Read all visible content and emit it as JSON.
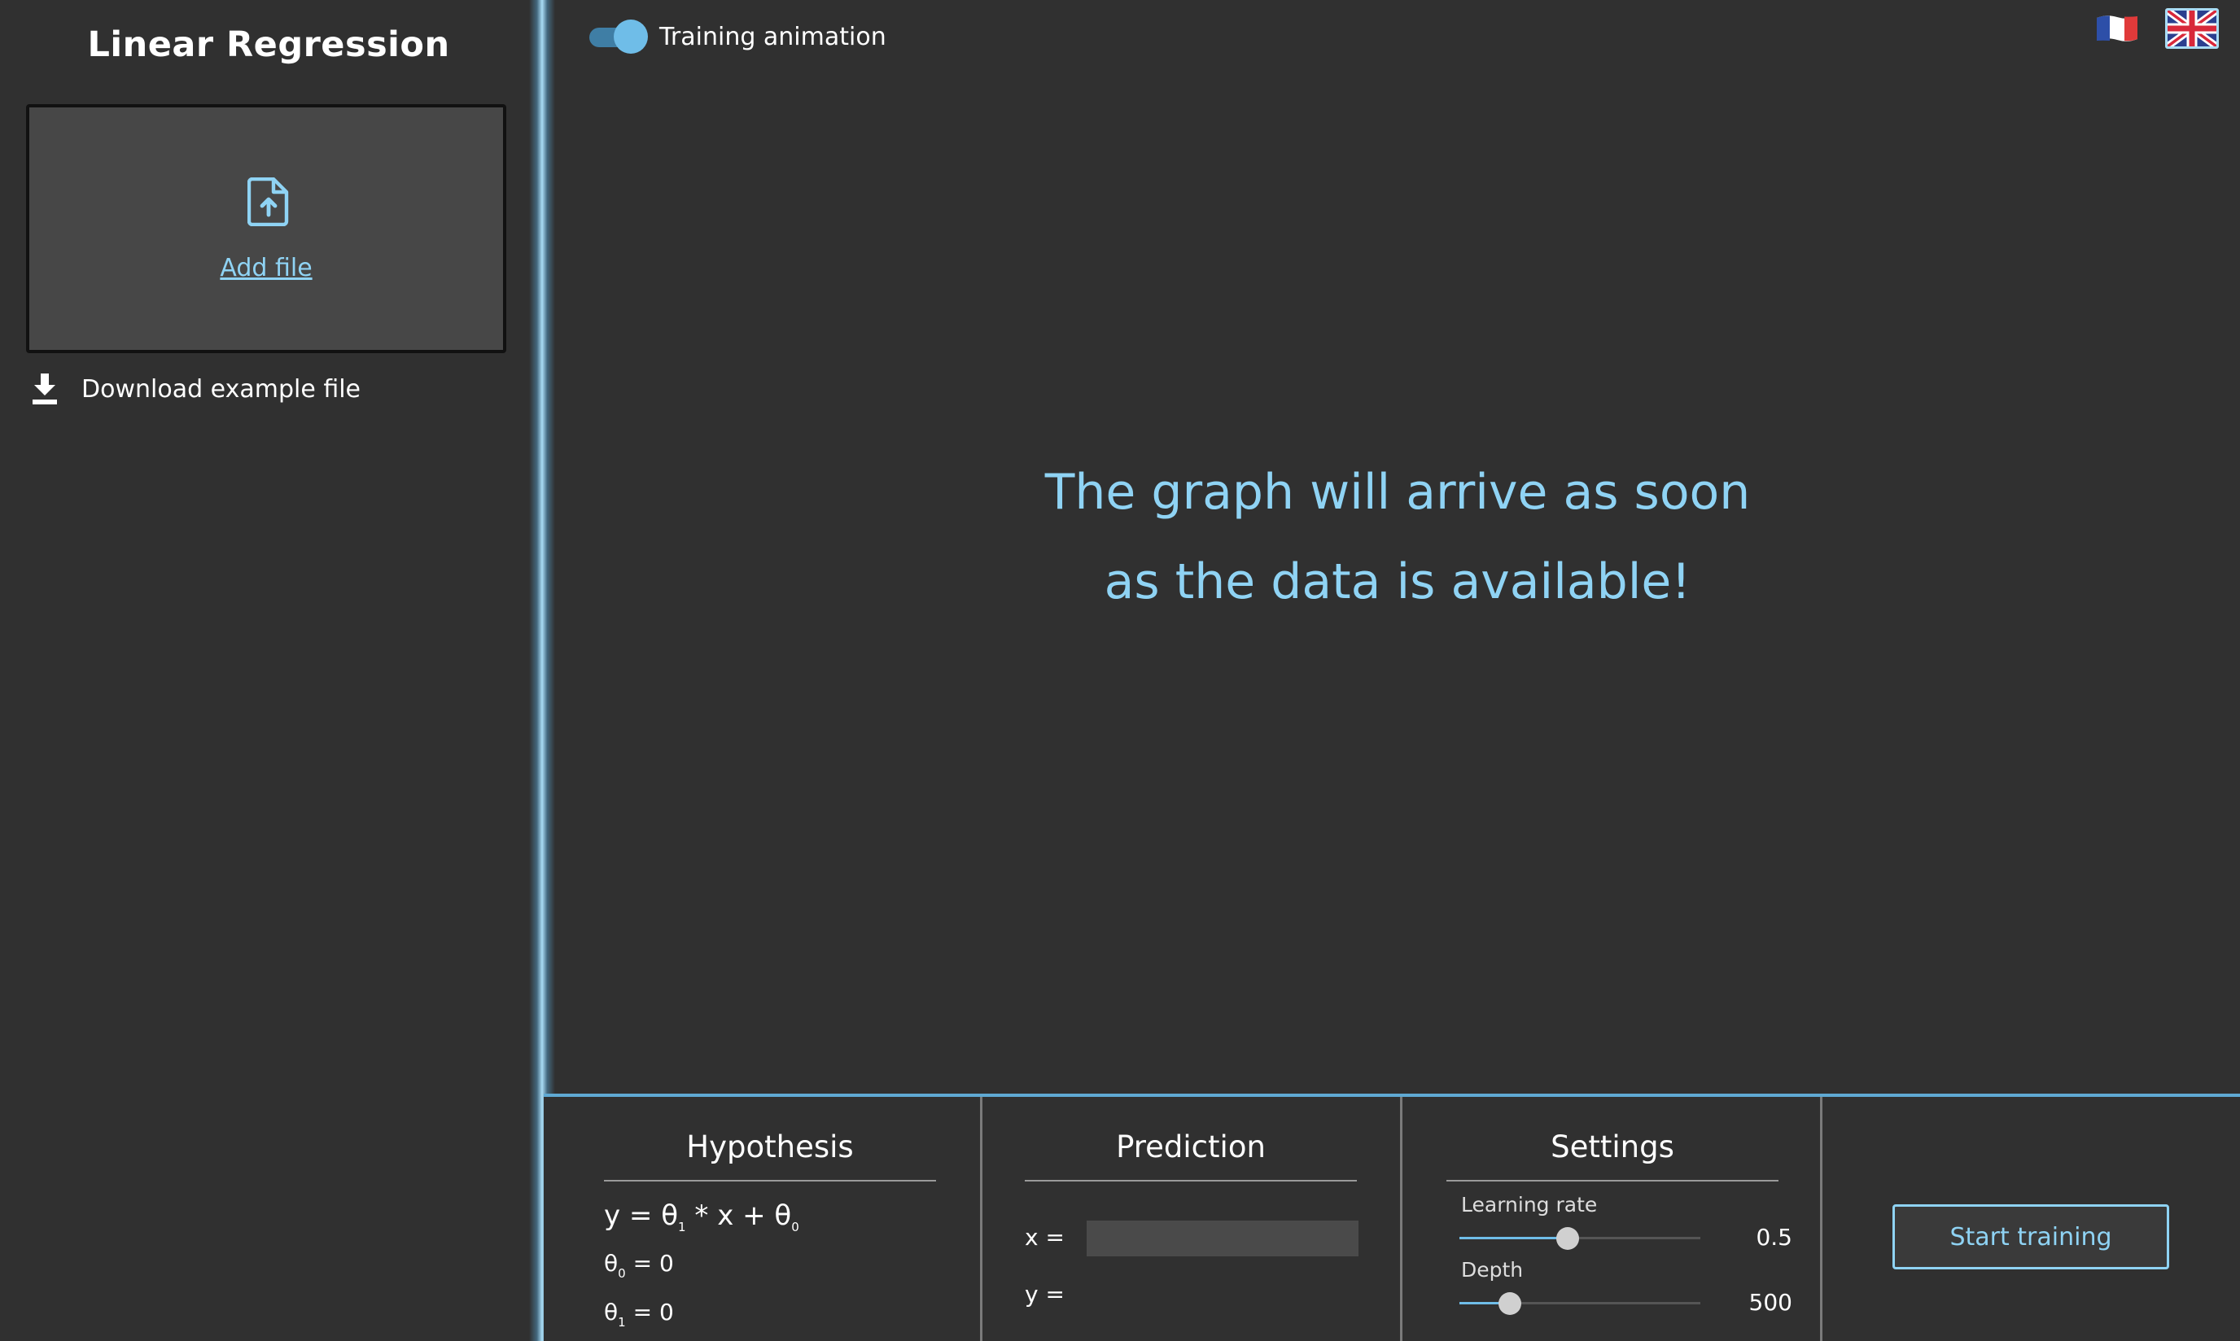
{
  "sidebar": {
    "title": "Linear Regression",
    "dropzone": {
      "add_file_label": "Add file",
      "icon": "file-upload-icon"
    },
    "download": {
      "label": "Download example file",
      "icon": "download-icon"
    }
  },
  "header": {
    "toggle": {
      "label": "Training animation",
      "checked": true
    },
    "languages": [
      {
        "code": "fr",
        "icon": "french-flag-icon"
      },
      {
        "code": "en",
        "icon": "uk-flag-icon",
        "selected": true
      }
    ]
  },
  "main": {
    "placeholder_line1": "The graph will arrive as soon",
    "placeholder_line2": "as the data is available!"
  },
  "hypothesis": {
    "title": "Hypothesis",
    "formula_prefix": "y = θ",
    "formula_sub1": "1",
    "formula_mid": " * x + θ",
    "formula_sub0": "0",
    "theta0_symbol": "θ",
    "theta0_sub": "0",
    "theta0_value": " = 0",
    "theta1_symbol": "θ",
    "theta1_sub": "1",
    "theta1_value": " = 0"
  },
  "prediction": {
    "title": "Prediction",
    "x_label": "x =",
    "x_value": "",
    "y_label": "y ="
  },
  "settings": {
    "title": "Settings",
    "learning_rate": {
      "label": "Learning rate",
      "value": "0.5",
      "fraction": 0.45
    },
    "depth": {
      "label": "Depth",
      "value": "500",
      "fraction": 0.21
    }
  },
  "actions": {
    "start_label": "Start training"
  },
  "colors": {
    "background": "#303030",
    "accent": "#8fd3f4",
    "dropzone": "#474747",
    "toggle_track": "#3f7ea5",
    "toggle_thumb": "#6fbde8"
  }
}
